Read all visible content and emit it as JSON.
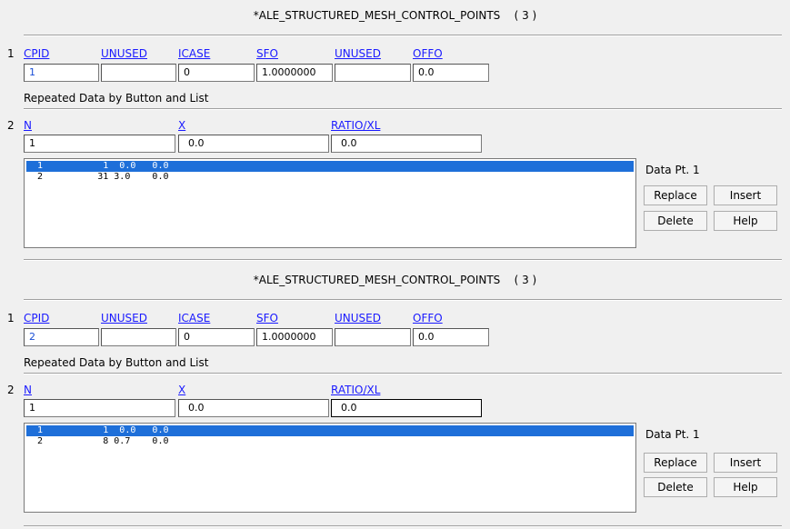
{
  "panels": [
    {
      "title": "*ALE_STRUCTURED_MESH_CONTROL_POINTS",
      "count": "( 3 )",
      "row1_num": "1",
      "row1": {
        "labels": [
          "CPID",
          "UNUSED",
          "ICASE",
          "SFO",
          "UNUSED",
          "OFFO"
        ],
        "values": [
          "1",
          "",
          "0",
          "1.0000000",
          "",
          "0.0"
        ]
      },
      "repeated_label": "Repeated Data by Button and List",
      "row2_num": "2",
      "row2": {
        "labels": [
          "N",
          "X",
          "RATIO/XL"
        ],
        "values": [
          "1",
          "0.0",
          "0.0"
        ]
      },
      "list": [
        "1           1  0.0   0.0",
        "2          31 3.0    0.0"
      ],
      "selected_row": 0,
      "data_pt": "Data Pt.  1",
      "buttons": {
        "replace": "Replace",
        "insert": "Insert",
        "delete": "Delete",
        "help": "Help"
      }
    },
    {
      "title": "*ALE_STRUCTURED_MESH_CONTROL_POINTS",
      "count": "( 3 )",
      "row1_num": "1",
      "row1": {
        "labels": [
          "CPID",
          "UNUSED",
          "ICASE",
          "SFO",
          "UNUSED",
          "OFFO"
        ],
        "values": [
          "2",
          "",
          "0",
          "1.0000000",
          "",
          "0.0"
        ]
      },
      "repeated_label": "Repeated Data by Button and List",
      "row2_num": "2",
      "row2": {
        "labels": [
          "N",
          "X",
          "RATIO/XL"
        ],
        "values": [
          "1",
          "0.0",
          "0.0"
        ]
      },
      "list": [
        "1           1  0.0   0.0",
        "2           8 0.7    0.0"
      ],
      "selected_row": 0,
      "data_pt": "Data Pt.  1",
      "buttons": {
        "replace": "Replace",
        "insert": "Insert",
        "delete": "Delete",
        "help": "Help"
      }
    }
  ],
  "colors": {
    "link": "#1a1aff",
    "selection": "#1e6fd9",
    "background": "#f0f0f0"
  }
}
